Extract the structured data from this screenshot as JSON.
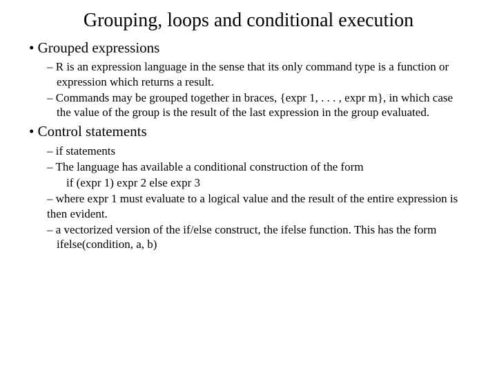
{
  "title": "Grouping, loops and conditional execution",
  "sections": [
    {
      "heading": "Grouped expressions",
      "items": [
        {
          "type": "l2",
          "text": "R is an expression language in the sense that its only command type is a function or expression which returns a result."
        },
        {
          "type": "l2",
          "text": "Commands may be grouped together in braces, {expr 1, . . . , expr m}, in which case the value of the group is the result of the last expression in the group evaluated."
        }
      ]
    },
    {
      "heading": "Control statements",
      "items": [
        {
          "type": "l2",
          "text": "if statements"
        },
        {
          "type": "l2",
          "text": "The language has available a conditional construction of the form"
        },
        {
          "type": "l3",
          "text": "if (expr 1) expr 2 else expr 3"
        },
        {
          "type": "l2cont",
          "text": "where expr 1 must evaluate to a logical value and the result of the entire expression is then evident."
        },
        {
          "type": "l2",
          "text": "a vectorized version of the if/else construct, the ifelse function. This has the form ifelse(condition, a, b)"
        }
      ]
    }
  ]
}
